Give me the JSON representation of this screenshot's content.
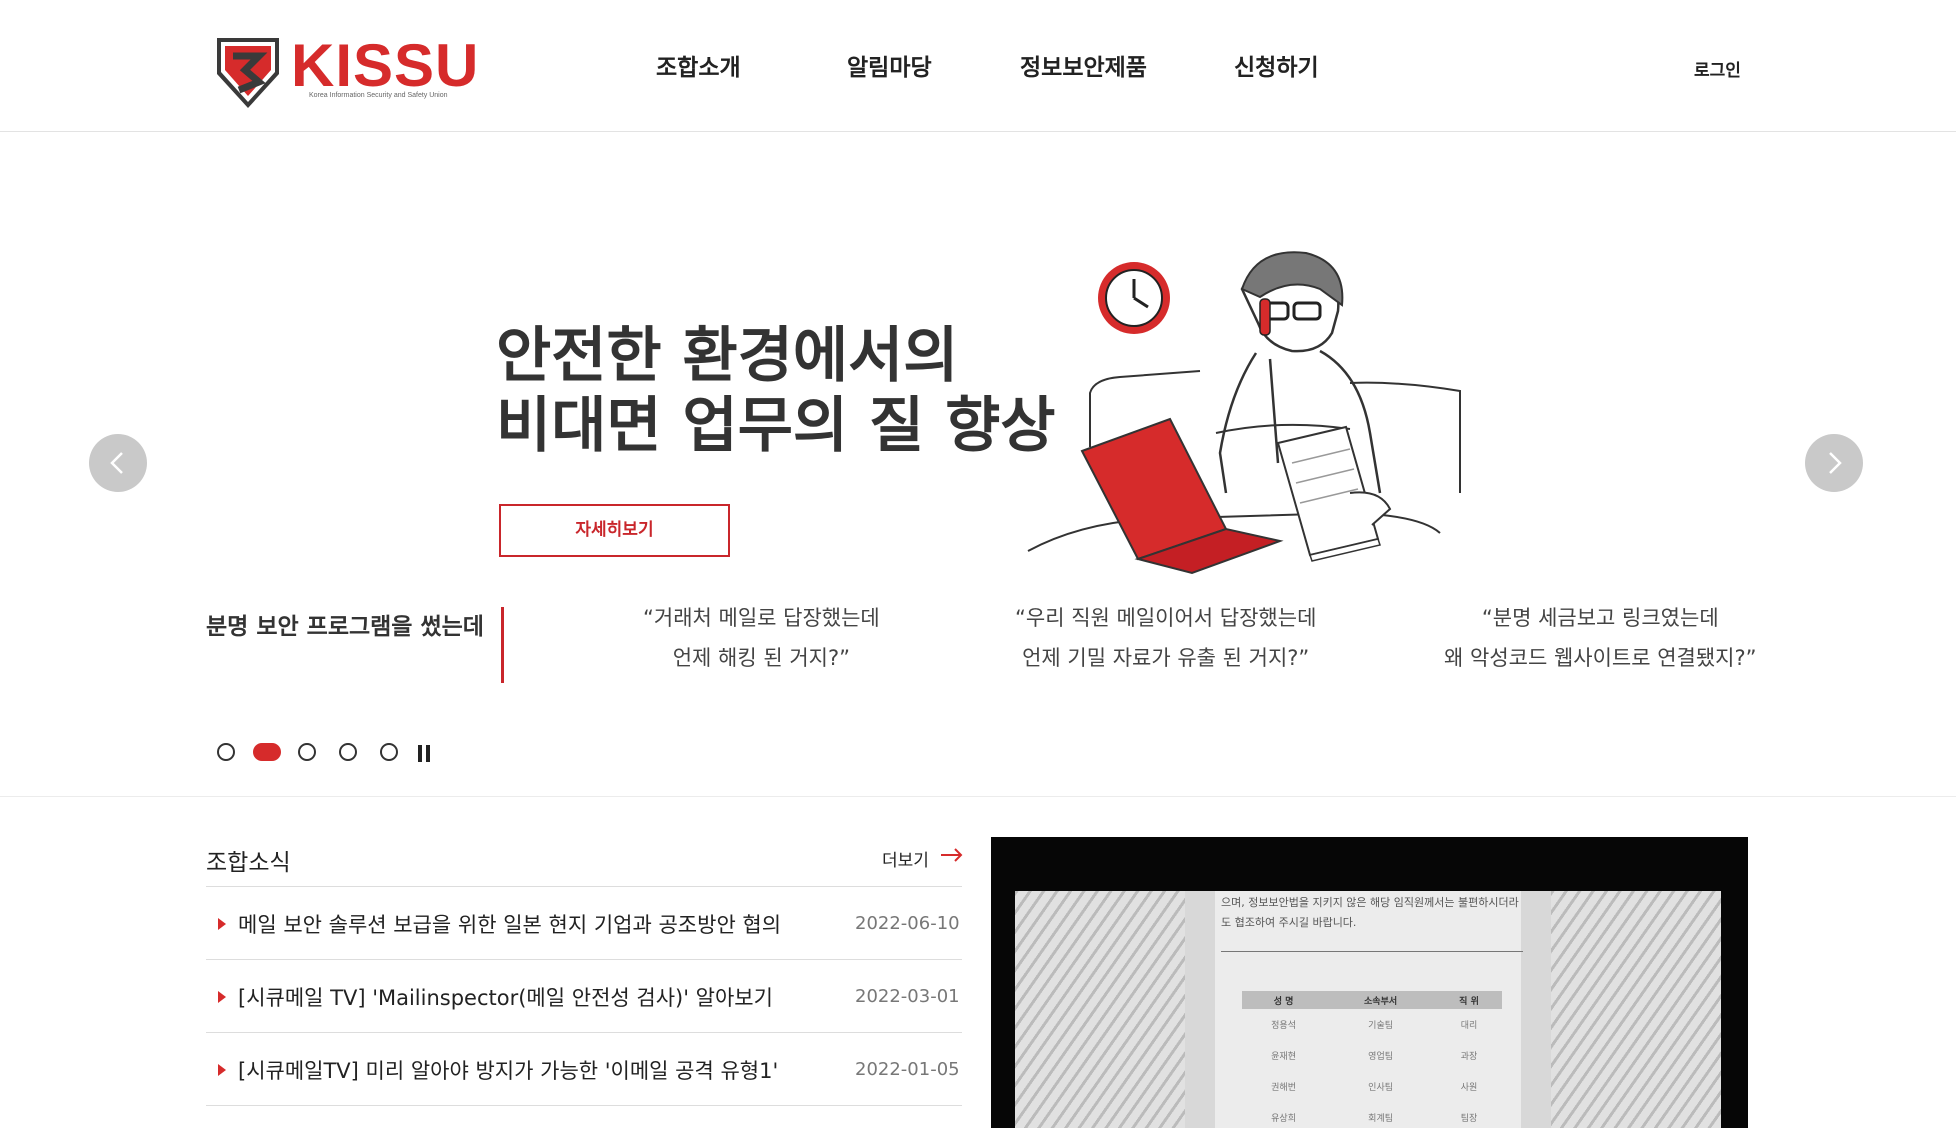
{
  "header": {
    "logo_text": "KISSU",
    "logo_subtitle": "Korea Information Security and Safety Union",
    "nav": [
      "조합소개",
      "알림마당",
      "정보보안제품",
      "신청하기"
    ],
    "login": "로그인"
  },
  "hero": {
    "title_line1": "안전한 환경에서의",
    "title_line2": "비대면 업무의 질 향상",
    "detail_button": "자세히보기",
    "lead": "분명 보안 프로그램을 썼는데",
    "quotes": [
      {
        "line1": "“거래처 메일로 답장했는데",
        "line2": "언제 해킹 된 거지?”"
      },
      {
        "line1": "“우리 직원 메일이어서 답장했는데",
        "line2": "언제 기밀 자료가 유출 된 거지?”"
      },
      {
        "line1": "“분명 세금보고 링크였는데",
        "line2": "왜 악성코드 웹사이트로 연결됐지?”"
      }
    ],
    "slide_count": 5,
    "active_slide": 2,
    "accent_color": "#d62b2b"
  },
  "news": {
    "title": "조합소식",
    "more": "더보기",
    "items": [
      {
        "title": "메일 보안 솔루션 보급을 위한 일본 현지 기업과 공조방안 협의",
        "date": "2022-06-10"
      },
      {
        "title": "[시큐메일 TV] 'Mailinspector(메일 안전성 검사)' 알아보기",
        "date": "2022-03-01"
      },
      {
        "title": "[시큐메일TV] 미리 알아야 방지가 가능한 '이메일 공격 유형1'",
        "date": "2022-01-05"
      }
    ]
  },
  "video": {
    "doc_line1": "으며, 정보보안법을 지키지 않은 해당 임직원께서는 불편하시더라",
    "doc_line2": "도 협조하여 주시길 바랍니다.",
    "table_headers": [
      "성 명",
      "소속부서",
      "직 위"
    ],
    "table_rows": [
      [
        "정용석",
        "기술팀",
        "대리"
      ],
      [
        "윤재현",
        "영업팀",
        "과장"
      ],
      [
        "권해번",
        "인사팀",
        "사원"
      ],
      [
        "유상희",
        "회계팀",
        "팀장"
      ]
    ]
  }
}
